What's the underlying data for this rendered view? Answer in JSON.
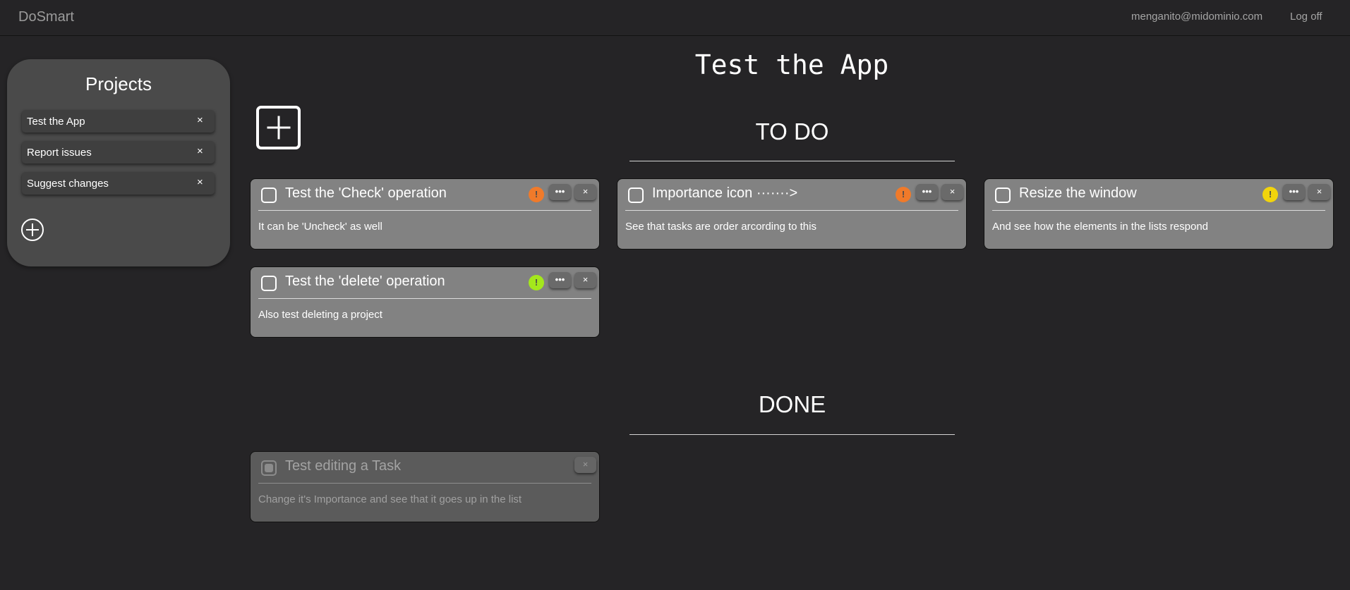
{
  "navbar": {
    "brand": "DoSmart",
    "email": "menganito@midominio.com",
    "logoff": "Log off"
  },
  "sidebar": {
    "title": "Projects",
    "items": [
      {
        "label": "Test the App",
        "remove": "×"
      },
      {
        "label": "Report issues",
        "remove": "×"
      },
      {
        "label": "Suggest changes",
        "remove": "×"
      }
    ]
  },
  "main": {
    "title": "Test the App",
    "todo_heading": "TO DO",
    "done_heading": "DONE"
  },
  "colors": {
    "importance_high": "#f07a2a",
    "importance_medium": "#f2d40c",
    "importance_low": "#a4e71c"
  },
  "todo_tasks": [
    {
      "title": "Test the 'Check' operation",
      "description": "It can be 'Uncheck' as well",
      "importance": "!",
      "more": "•••",
      "close": "×"
    },
    {
      "title": "Importance icon ·······>",
      "description": "See that tasks are order arcording to this",
      "importance": "!",
      "more": "•••",
      "close": "×"
    },
    {
      "title": "Resize the window",
      "description": "And see how the elements in the lists respond",
      "importance": "!",
      "more": "•••",
      "close": "×"
    },
    {
      "title": "Test the 'delete' operation",
      "description": "Also test deleting a project",
      "importance": "!",
      "more": "•••",
      "close": "×"
    }
  ],
  "done_tasks": [
    {
      "title": "Test editing a Task",
      "description": "Change it's Importance and see that it goes up in the list",
      "close": "×"
    }
  ]
}
